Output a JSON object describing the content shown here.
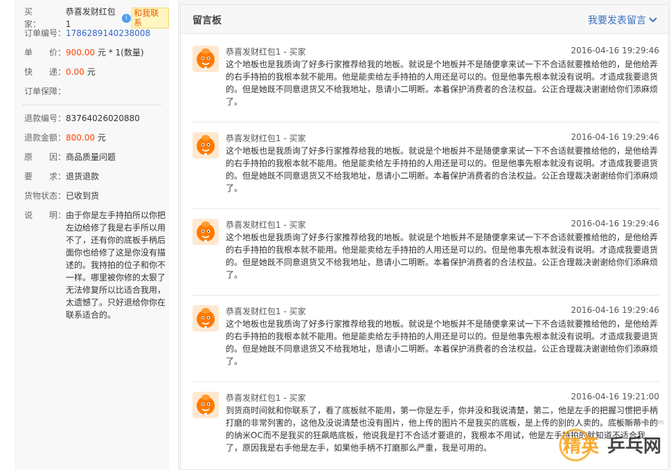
{
  "order": {
    "buyer_label": "买　　家：",
    "buyer": "恭喜发财红包1",
    "contact_label": "和我联系",
    "order_no_label": "订单编号：",
    "order_no": "1786289140238008",
    "price_label": "单　　价：",
    "price": "900.00",
    "price_suffix": "元 * 1(数量)",
    "shipping_label": "快　　递：",
    "shipping": "0.00",
    "shipping_suffix": "元",
    "guarantee_label": "订单保障："
  },
  "refund": {
    "no_label": "退款编号：",
    "no": "83764026020880",
    "amount_label": "退款金额：",
    "amount": "800.00",
    "amount_suffix": "元",
    "reason_label": "原　　因：",
    "reason": "商品质量问题",
    "request_label": "要　　求：",
    "request": "退货退款",
    "goods_label": "货物状态：",
    "goods": "已收到货",
    "desc_label": "说　　明：",
    "desc": "由于你是左手持拍所以你把左边给修了我是右手所以用不了，还有你的底板手柄后面你也给修了这是你没有描述的。我持拍的位子和你不一样。哪里被你修的太狠了无法修复所以比适合我用，太遗憾了。只好退给你你在联系适合的。"
  },
  "board": {
    "title": "留言板",
    "post_label": "我要发表留言",
    "messages": [
      {
        "author": "恭喜发财红包1 - 买家",
        "time": "2016-04-16 19:29:46",
        "body": "这个地板也是我质询了好多行家推荐给我的地板。就说是个地板并不是随便拿来试一下不合适就要推给他的，是他给弄的右手持拍的我根本就不能用。他是能卖给左手持拍的人用还是可以的。但是他事先根本就没有说明。才造成我要退货的。但是她既不同意退货又不给我地址，恳请小二明断。本着保护消费者的合法权益。公正合理裁决谢谢给你们添麻烦了。"
      },
      {
        "author": "恭喜发财红包1 - 买家",
        "time": "2016-04-16 19:29:46",
        "body": "这个地板也是我质询了好多行家推荐给我的地板。就说是个地板并不是随便拿来试一下不合适就要推给他的，是他给弄的右手持拍的我根本就不能用。他是能卖给左手持拍的人用还是可以的。但是他事先根本就没有说明。才造成我要退货的。但是她既不同意退货又不给我地址，恳请小二明断。本着保护消费者的合法权益。公正合理裁决谢谢给你们添麻烦了。"
      },
      {
        "author": "恭喜发财红包1 - 买家",
        "time": "2016-04-16 19:29:46",
        "body": "这个地板也是我质询了好多行家推荐给我的地板。就说是个地板并不是随便拿来试一下不合适就要推给他的，是他给弄的右手持拍的我根本就不能用。他是能卖给左手持拍的人用还是可以的。但是他事先根本就没有说明。才造成我要退货的。但是她既不同意退货又不给我地址，恳请小二明断。本着保护消费者的合法权益。公正合理裁决谢谢给你们添麻烦了。"
      },
      {
        "author": "恭喜发财红包1 - 买家",
        "time": "2016-04-16 19:29:46",
        "body": "这个地板也是我质询了好多行家推荐给我的地板。就说是个地板并不是随便拿来试一下不合适就要推给他的，是他给弄的右手持拍的我根本就不能用。他是能卖给左手持拍的人用还是可以的。但是他事先根本就没有说明。才造成我要退货的。但是她既不同意退货又不给我地址，恳请小二明断。本着保护消费者的合法权益。公正合理裁决谢谢给你们添麻烦了。"
      },
      {
        "author": "恭喜发财红包1 - 买家",
        "time": "2016-04-16 19:21:00",
        "body": "到货商时间就和你联系了，看了底板就不能用，第一你是左手，你并没和我说清楚，第二，他是左手的把握习惯把手柄打磨的非常列害的，这他及没说清楚也没有图片，他上传的图片不是我买的底板，是上传的别的人卖的。底板斯蒂卡的的纳米OC而不是我买的狂飙皓底板，他说我是打不合适才要退的，我根本不用试，他是左手持拍的就知道不适合我了，原因我是右手他是左手，如果他手柄不打磨那么严重，我是可用的。"
      }
    ]
  },
  "watermark": {
    "site": "cnpingpang.com",
    "text_a": "精英",
    "text_b": "乒乓网"
  }
}
